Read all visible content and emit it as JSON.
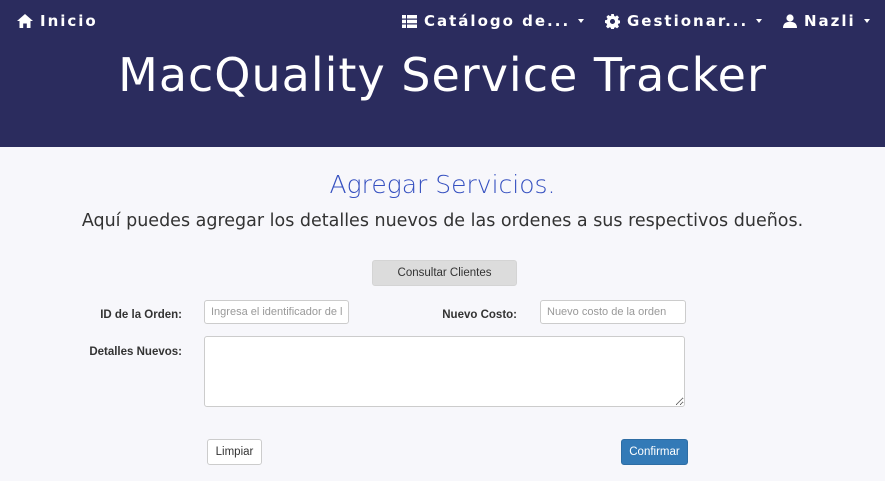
{
  "nav": {
    "home_label": "Inicio",
    "catalog_label": "Catálogo de...",
    "manage_label": "Gestionar...",
    "user_label": "Nazli"
  },
  "header": {
    "title": "MacQuality Service Tracker"
  },
  "main": {
    "title": "Agregar Servicios.",
    "subtitle": "Aquí puedes agregar los detalles nuevos de las ordenes a sus respectivos dueños.",
    "consult_button_label": "Consultar Clientes"
  },
  "form": {
    "order_id_label": "ID de la Orden:",
    "order_id_placeholder": "Ingresa el identificador de la orden",
    "order_id_value": "",
    "new_cost_label": "Nuevo Costo:",
    "new_cost_placeholder": "Nuevo costo de la orden",
    "new_cost_value": "",
    "details_label": "Detalles Nuevos:",
    "details_value": "",
    "clear_button_label": "Limpiar",
    "confirm_button_label": "Confirmar"
  },
  "colors": {
    "header_bg": "#2b2c5e",
    "title_accent": "#3550c0",
    "confirm_button": "#337ab7"
  },
  "icons": {
    "home": "home-icon",
    "catalog": "table-icon",
    "manage": "gear-icon",
    "user": "user-icon"
  }
}
